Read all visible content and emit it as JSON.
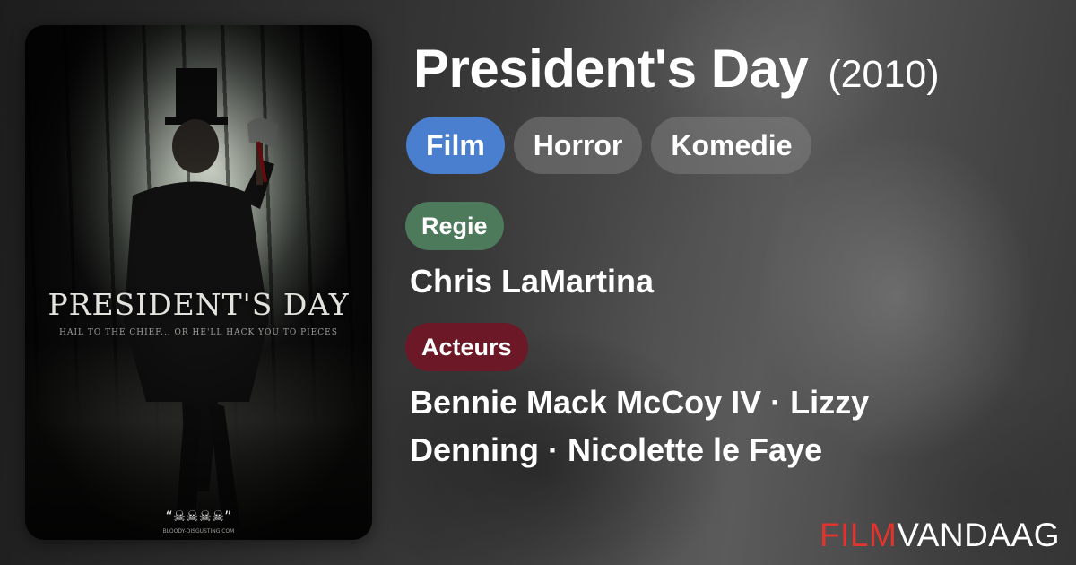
{
  "movie": {
    "title": "President's Day",
    "year": "(2010)"
  },
  "poster": {
    "title": "PRESIDENT'S DAY",
    "tagline": "HAIL TO THE CHIEF... OR HE'LL HACK YOU TO PIECES",
    "rating": "“☠☠☠☠”",
    "site": "BLOODY-DISGUSTING.COM"
  },
  "genres": [
    "Film",
    "Horror",
    "Komedie"
  ],
  "director": {
    "label": "Regie",
    "name": "Chris LaMartina"
  },
  "cast": {
    "label": "Acteurs",
    "names": "Bennie Mack McCoy IV · Lizzy Denning · Nicolette le Faye"
  },
  "brand": {
    "part1": "FILM",
    "part2": "VANDAAG"
  },
  "colors": {
    "genre_primary": "#4a7fd0",
    "regie_badge": "#4e7a5c",
    "acteurs_badge": "#6c1826",
    "brand_red": "#e0342f"
  }
}
